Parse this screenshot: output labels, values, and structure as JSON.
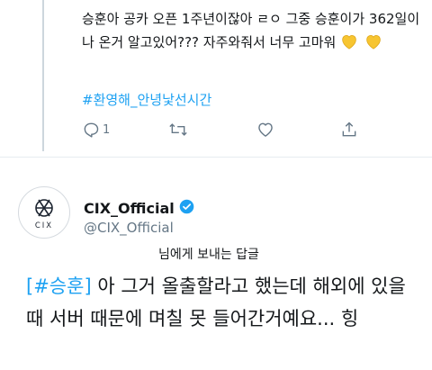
{
  "previous_tweet": {
    "text": "승훈아 공카 오픈 1주년이잖아 ㄹㅇ 그중 승훈이가 362일이나 온거 알고있어??? 자주와줘서 너무 고마워",
    "emoji_icons": [
      "yellow-heart-icon",
      "yellow-heart-icon"
    ],
    "hashtag": "#환영해_안녕낯선시간",
    "actions": {
      "reply_count": "1",
      "retweet_count": "",
      "like_count": ""
    }
  },
  "reply_tweet": {
    "display_name": "CIX_Official",
    "handle": "@CIX_Official",
    "reply_label": "님에게 보내는 답글",
    "hashtag_prefix": "[",
    "hashtag": "#승훈",
    "hashtag_suffix": "]",
    "body": " 아 그거 올출할라고 했는데 해외에 있을때 서버 때문에 며칠 못 들어간거예요... 힝"
  },
  "avatar": {
    "logo_text": "CIX"
  },
  "colors": {
    "accent": "#1da1f2",
    "text": "#14171a",
    "secondary": "#657786",
    "heart": "#f7c531",
    "thread_line": "#cdd6dd"
  }
}
